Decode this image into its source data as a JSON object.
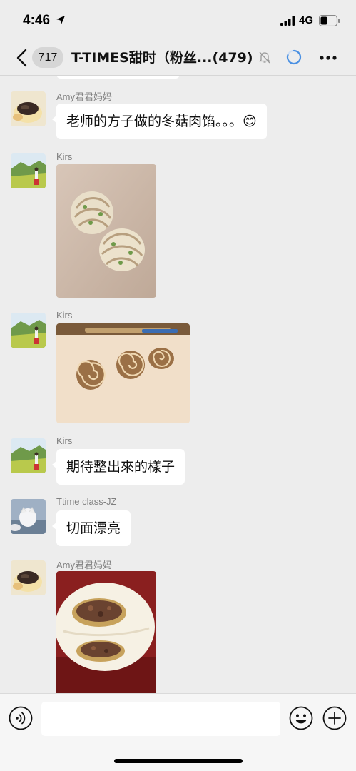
{
  "status_bar": {
    "time": "4:46",
    "network": "4G",
    "icons": [
      "location-arrow-icon",
      "signal-icon",
      "battery-icon"
    ]
  },
  "nav": {
    "back_badge": "717",
    "title": "T-TIMES甜时（粉丝...(479)",
    "icons": [
      "back-chevron-icon",
      "mute-bell-icon",
      "loading-icon",
      "more-dots-icon"
    ]
  },
  "messages": [
    {
      "sender": "Amy君君妈妈",
      "type": "text",
      "text": "老师的方子做的冬菇肉馅。。。😊"
    },
    {
      "sender": "Kirs",
      "type": "image",
      "image": "scallion-pastry-rolls-photo"
    },
    {
      "sender": "Kirs",
      "type": "image",
      "image": "spiral-dough-slices-photo"
    },
    {
      "sender": "Kirs",
      "type": "text",
      "text": "期待整出來的樣子"
    },
    {
      "sender": "Ttime class-JZ",
      "type": "text",
      "text": "切面漂亮"
    },
    {
      "sender": "Amy君君妈妈",
      "type": "image",
      "image": "meat-bun-cross-section-photo"
    }
  ],
  "input_bar": {
    "placeholder": "",
    "icons": [
      "voice-icon",
      "emoji-icon",
      "plus-icon"
    ]
  },
  "colors": {
    "background": "#ededed",
    "bubble": "#ffffff",
    "sender_name": "#7f7f7f",
    "loading_accent": "#4a90e2"
  }
}
